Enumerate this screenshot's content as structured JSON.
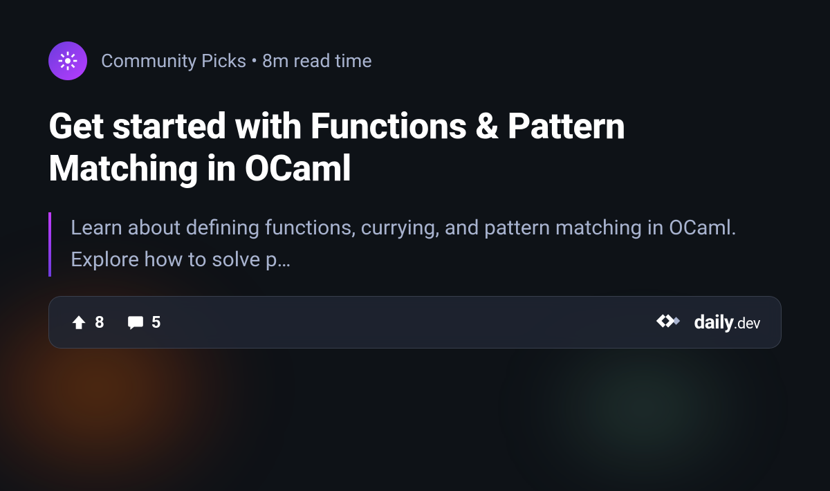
{
  "meta": {
    "source": "Community Picks",
    "separator": " • ",
    "read_time": "8m read time"
  },
  "title": "Get started with Functions & Pattern Matching in OCaml",
  "description": "Learn about defining functions, currying, and pattern matching in OCaml. Explore how to solve p…",
  "stats": {
    "upvotes": "8",
    "comments": "5"
  },
  "brand": {
    "name": "daily",
    "suffix": ".dev"
  }
}
